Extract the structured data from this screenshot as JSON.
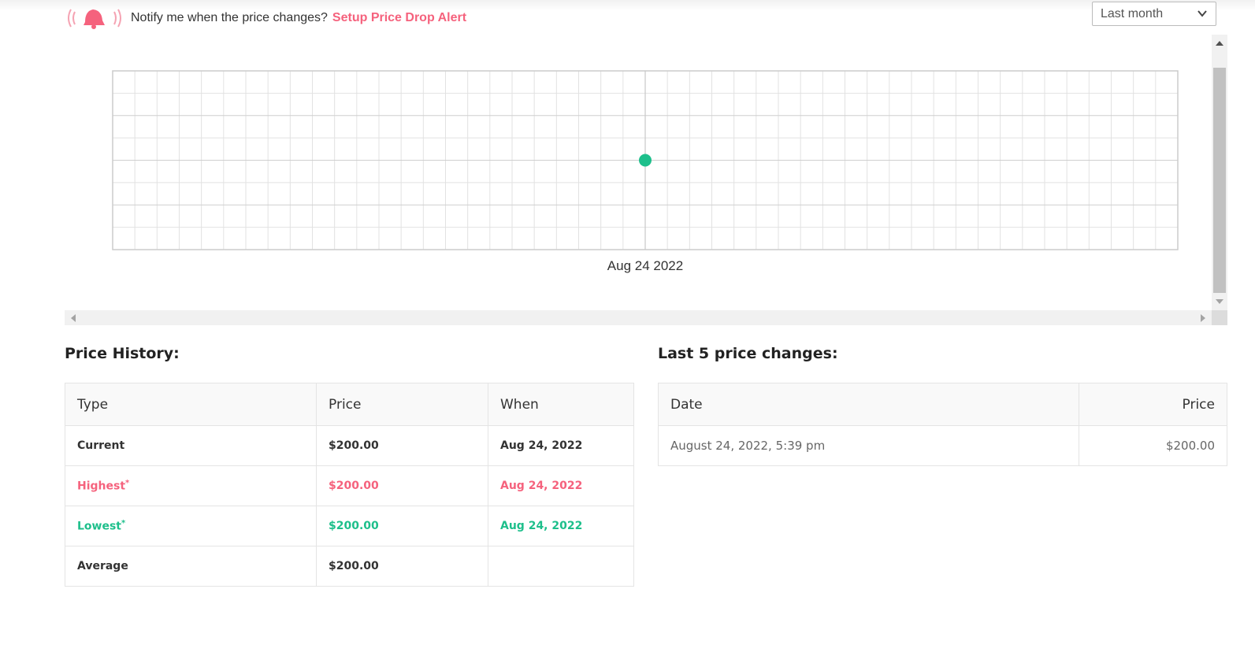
{
  "header": {
    "bell_icon": "ringing-bell-icon",
    "notify_text": "Notify me when the price changes?",
    "alert_link": "Setup Price Drop Alert",
    "range_selected": "Last month"
  },
  "colors": {
    "accent_red": "#f5627d",
    "accent_green": "#1dbf8b",
    "grid": "#e2e2e2"
  },
  "chart_data": {
    "type": "scatter",
    "x_tick_labels": [
      "Aug 24 2022"
    ],
    "points": [
      {
        "x": "Aug 24 2022",
        "y": 200.0
      }
    ],
    "grid": true,
    "point_color": "#1dbf8b"
  },
  "price_history": {
    "title": "Price History:",
    "columns": [
      "Type",
      "Price",
      "When"
    ],
    "rows": [
      {
        "type": "Current",
        "price": "$200.00",
        "when": "Aug 24, 2022",
        "star": ""
      },
      {
        "type": "Highest",
        "price": "$200.00",
        "when": "Aug 24, 2022",
        "star": "*"
      },
      {
        "type": "Lowest",
        "price": "$200.00",
        "when": "Aug 24, 2022",
        "star": "*"
      },
      {
        "type": "Average",
        "price": "$200.00",
        "when": "",
        "star": ""
      }
    ]
  },
  "last_changes": {
    "title": "Last 5 price changes:",
    "columns": [
      "Date",
      "Price"
    ],
    "rows": [
      {
        "date": "August 24, 2022, 5:39 pm",
        "price": "$200.00"
      }
    ]
  }
}
